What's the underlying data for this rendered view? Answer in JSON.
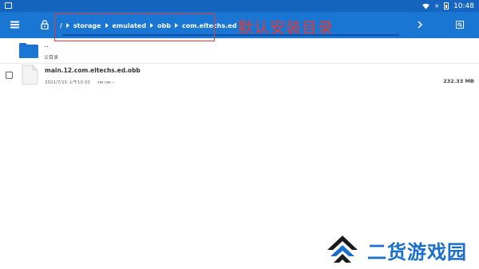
{
  "status_bar": {
    "time": "10:48",
    "battery_mark": "✕"
  },
  "breadcrumb": {
    "items": [
      "/",
      "storage",
      "emulated",
      "obb",
      "com.eltechs.ed"
    ]
  },
  "annotation": {
    "label": "默认安装目录"
  },
  "parent_folder": {
    "name": "..",
    "label": "父目录"
  },
  "files": [
    {
      "name": "main.12.com.eltechs.ed.obb",
      "date": "2021/7/15 上午10:33",
      "perms": "-rw-rw---",
      "size": "232.33 MB"
    }
  ],
  "watermark": {
    "text": "二货游戏园"
  },
  "colors": {
    "toolbar": "#1976d2",
    "status_bar": "#1565c0",
    "folder": "#1e6fd0",
    "annotation": "#e53935",
    "watermark": "#1a6fcc"
  }
}
